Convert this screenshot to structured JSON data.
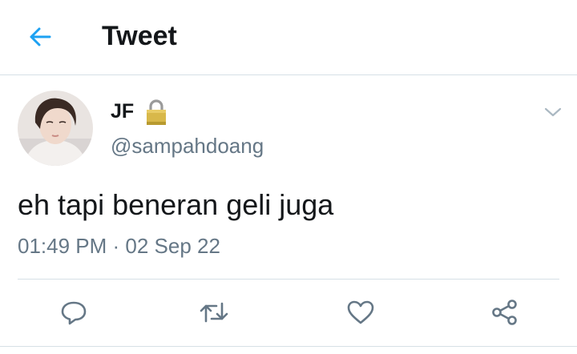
{
  "header": {
    "title": "Tweet",
    "back_icon": "arrow-left-icon"
  },
  "tweet": {
    "display_name": "JF",
    "protected_icon": "lock-icon",
    "handle": "@sampahdoang",
    "text": "eh tapi beneran geli juga",
    "timestamp": "01:49 PM · 02 Sep 22",
    "menu_icon": "chevron-down-icon"
  },
  "actions": [
    {
      "name": "reply",
      "icon": "reply-icon"
    },
    {
      "name": "retweet",
      "icon": "retweet-icon"
    },
    {
      "name": "like",
      "icon": "heart-icon"
    },
    {
      "name": "share",
      "icon": "share-icon"
    }
  ],
  "colors": {
    "accent": "#1da1f2",
    "text": "#14171a",
    "secondary": "#657786",
    "divider": "#d6e0e6"
  }
}
